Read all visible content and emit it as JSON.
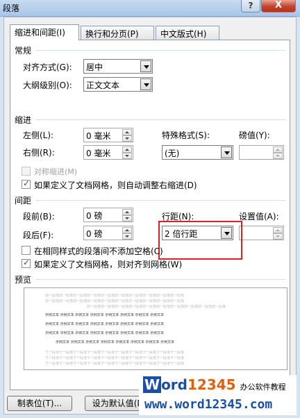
{
  "window": {
    "title": "段落",
    "help_label": "?",
    "close_label": "X"
  },
  "tabs": [
    {
      "label": "缩进和间距(I)"
    },
    {
      "label": "换行和分页(P)"
    },
    {
      "label": "中文版式(H)"
    }
  ],
  "general": {
    "group_label": "常规",
    "alignment_label": "对齐方式(G):",
    "alignment_value": "居中",
    "outline_label": "大纲级别(O):",
    "outline_value": "正文文本"
  },
  "indent": {
    "group_label": "缩进",
    "left_label": "左侧(L):",
    "left_value": "0 毫米",
    "right_label": "右侧(R):",
    "right_value": "0 毫米",
    "special_label": "特殊格式(S):",
    "special_value": "(无)",
    "by_label": "磅值(Y):",
    "by_value": "",
    "mirror_label": "对称缩进(M)",
    "mirror_checked": false,
    "auto_adjust_label": "如果定义了文档网格，则自动调整右缩进(D)",
    "auto_adjust_checked": true
  },
  "spacing": {
    "group_label": "间距",
    "before_label": "段前(B):",
    "before_value": "0 磅",
    "after_label": "段后(F):",
    "after_value": "0 磅",
    "line_spacing_label": "行距(N):",
    "line_spacing_value": "2 倍行距",
    "at_label": "设置值(A):",
    "at_value": "",
    "no_space_same_style_label": "在相同样式的段落间不添加空格(C)",
    "no_space_same_style_checked": false,
    "snap_to_grid_label": "如果定义了文档网格，则对齐到网格(W)",
    "snap_to_grid_checked": true
  },
  "preview": {
    "group_label": "预览",
    "prev_text": "前一段落前一段落前一段落前一段落前一段落前一段落前一段落前一段落前一段落前一段落",
    "sample_text": "示例文本 示例文本 示例文本 示例文本 示例文本 示例文本 示例文本 示例文本",
    "next_text": "下一段落下一段落下一段落下一段落下一段落下一段落下一段落下一段落下一段落下一段落"
  },
  "buttons": {
    "tabs_label": "制表位(T)...",
    "default_label": "设为默认值(D)"
  },
  "watermark": {
    "logo_w": "W",
    "logo_ord": "ord",
    "logo_num": "12345",
    "logo_tagline": "办公软件教程",
    "url": "www.word12345.com"
  }
}
